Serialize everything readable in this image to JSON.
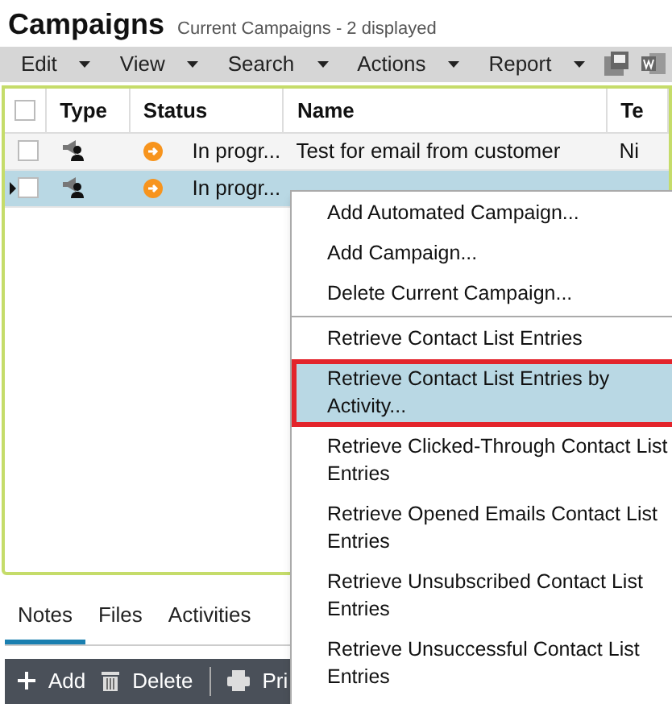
{
  "header": {
    "title": "Campaigns",
    "subtitle": "Current Campaigns - 2 displayed"
  },
  "toolbar": {
    "menus": [
      "Edit",
      "View",
      "Search",
      "Actions",
      "Report"
    ]
  },
  "table": {
    "columns": [
      "Type",
      "Status",
      "Name",
      "Te"
    ],
    "header_checked": false,
    "rows": [
      {
        "selected": false,
        "checked": false,
        "status": "In progr...",
        "name": "Test for email from customer",
        "column_5": "Ni"
      },
      {
        "selected": true,
        "checked": false,
        "status": "In progr..."
      }
    ]
  },
  "tabs": [
    {
      "label": "Notes",
      "selected": true
    },
    {
      "label": "Files",
      "selected": false
    },
    {
      "label": "Activities",
      "selected": false
    }
  ],
  "bottom_toolbar": [
    {
      "kind": "add",
      "label": "Add"
    },
    {
      "kind": "delete",
      "label": "Delete"
    },
    {
      "kind": "print",
      "label": "Pri"
    }
  ],
  "context_menu": [
    {
      "label": "Add Automated Campaign...",
      "selected": false,
      "separator_before": false
    },
    {
      "label": "Add Campaign...",
      "selected": false,
      "separator_before": false
    },
    {
      "label": "Delete Current Campaign...",
      "selected": false,
      "separator_before": false
    },
    {
      "label": "Retrieve Contact List Entries",
      "selected": false,
      "separator_before": true
    },
    {
      "label": "Retrieve Contact List Entries by Activity...",
      "selected": true,
      "separator_before": false
    },
    {
      "label": "Retrieve Clicked-Through Contact List Entries",
      "selected": false,
      "separator_before": false
    },
    {
      "label": "Retrieve Opened Emails Contact List Entries",
      "selected": false,
      "separator_before": false
    },
    {
      "label": "Retrieve Unsubscribed Contact List Entries",
      "selected": false,
      "separator_before": false
    },
    {
      "label": "Retrieve Unsuccessful Contact List Entries",
      "selected": false,
      "separator_before": false
    }
  ]
}
